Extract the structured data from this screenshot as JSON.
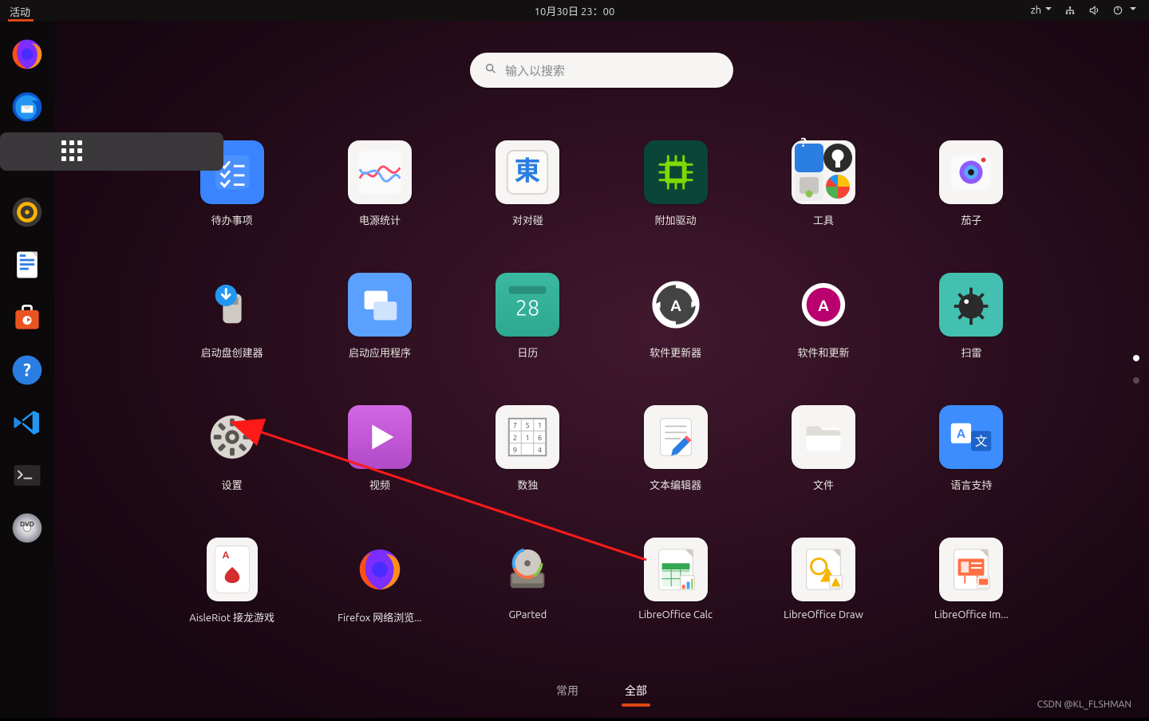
{
  "panel": {
    "activities": "活动",
    "clock": "10月30日  23：00",
    "lang": "zh"
  },
  "search": {
    "placeholder": "输入以搜索"
  },
  "dock": [
    {
      "name": "firefox"
    },
    {
      "name": "thunderbird"
    },
    {
      "name": "files"
    },
    {
      "name": "rhythmbox"
    },
    {
      "name": "libreoffice-writer"
    },
    {
      "name": "ubuntu-software"
    },
    {
      "name": "help"
    },
    {
      "name": "vscode"
    },
    {
      "name": "terminal"
    },
    {
      "name": "dvd"
    }
  ],
  "apps": [
    {
      "id": "todo",
      "label": "待办事项"
    },
    {
      "id": "power-stats",
      "label": "电源统计"
    },
    {
      "id": "mahjongg",
      "label": "对对碰"
    },
    {
      "id": "additional-drivers",
      "label": "附加驱动"
    },
    {
      "id": "utilities",
      "label": "工具"
    },
    {
      "id": "cheese",
      "label": "茄子"
    },
    {
      "id": "startup-disk-creator",
      "label": "启动盘创建器"
    },
    {
      "id": "startup-apps",
      "label": "启动应用程序"
    },
    {
      "id": "calendar",
      "label": "日历"
    },
    {
      "id": "software-updater",
      "label": "软件更新器"
    },
    {
      "id": "software-and-updates",
      "label": "软件和更新"
    },
    {
      "id": "mines",
      "label": "扫雷"
    },
    {
      "id": "settings",
      "label": "设置"
    },
    {
      "id": "videos",
      "label": "视频"
    },
    {
      "id": "sudoku",
      "label": "数独"
    },
    {
      "id": "text-editor",
      "label": "文本编辑器"
    },
    {
      "id": "files-app",
      "label": "文件"
    },
    {
      "id": "language-support",
      "label": "语言支持"
    },
    {
      "id": "aisleriot",
      "label": "AisleRiot 接龙游戏"
    },
    {
      "id": "firefox",
      "label": "Firefox 网络浏览..."
    },
    {
      "id": "gparted",
      "label": "GParted"
    },
    {
      "id": "libreoffice-calc",
      "label": "LibreOffice Calc"
    },
    {
      "id": "libreoffice-draw",
      "label": "LibreOffice Draw"
    },
    {
      "id": "libreoffice-impress",
      "label": "LibreOffice Im..."
    }
  ],
  "calendar_day": "28",
  "tabs": {
    "frequent": "常用",
    "all": "全部",
    "active": "all"
  },
  "watermark": "CSDN @KL_FLSHMAN"
}
